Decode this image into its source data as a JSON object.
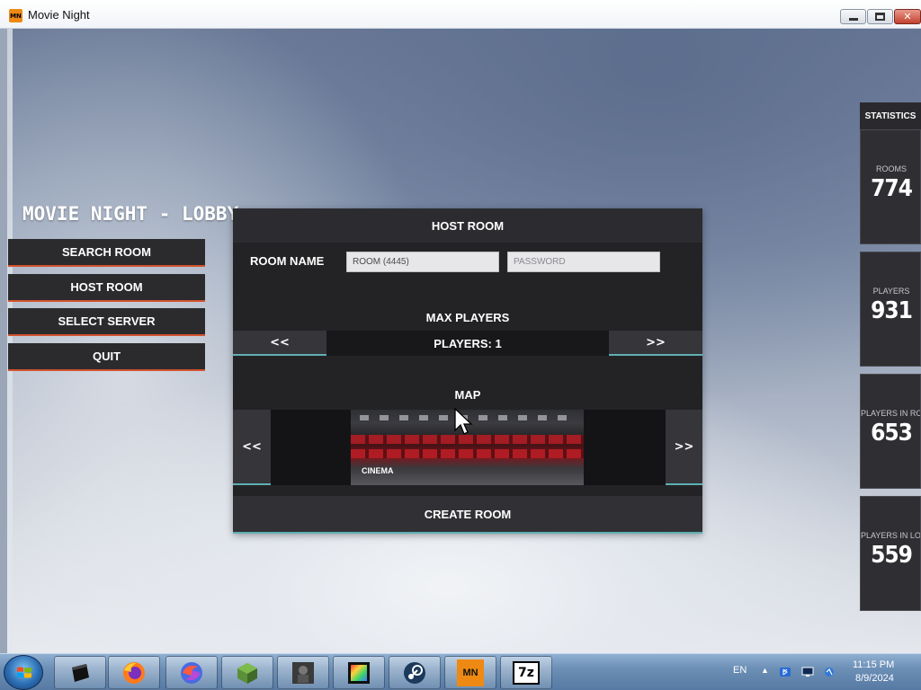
{
  "window": {
    "title": "Movie Night",
    "app_icon_text": "MN"
  },
  "lobby": {
    "title": "MOVIE NIGHT - LOBBY",
    "menu": [
      {
        "id": "search",
        "label": "SEARCH ROOM"
      },
      {
        "id": "host",
        "label": "HOST ROOM"
      },
      {
        "id": "server",
        "label": "SELECT SERVER"
      },
      {
        "id": "quit",
        "label": "QUIT"
      }
    ]
  },
  "host_room": {
    "header": "HOST ROOM",
    "room_name_label": "ROOM NAME",
    "room_name_value": "ROOM (4445)",
    "password_placeholder": "PASSWORD",
    "max_players_label": "MAX PLAYERS",
    "players_display": "PLAYERS: 1",
    "prev_label": "<<",
    "next_label": ">>",
    "map_label": "MAP",
    "map_name": "CINEMA",
    "create_label": "CREATE ROOM"
  },
  "statistics": {
    "header": "STATISTICS",
    "cards": [
      {
        "label": "ROOMS",
        "value": "774"
      },
      {
        "label": "PLAYERS",
        "value": "931"
      },
      {
        "label": "PLAYERS IN ROOM",
        "value": "653"
      },
      {
        "label": "PLAYERS IN LOBBY",
        "value": "559"
      }
    ]
  },
  "taskbar": {
    "apps": [
      "terminal-icon",
      "firefox-icon",
      "browser-icon",
      "minecraft-icon",
      "game-icon",
      "frame-icon",
      "steam-icon",
      "movie-night-icon",
      "7zip-icon"
    ],
    "movie_night_text": "MN",
    "zip_text": "7z",
    "language": "EN",
    "time": "11:15 PM",
    "date": "8/9/2024"
  },
  "colors": {
    "accent_orange": "#d2522e",
    "accent_teal": "#5fb0b4",
    "panel": "#232326"
  }
}
